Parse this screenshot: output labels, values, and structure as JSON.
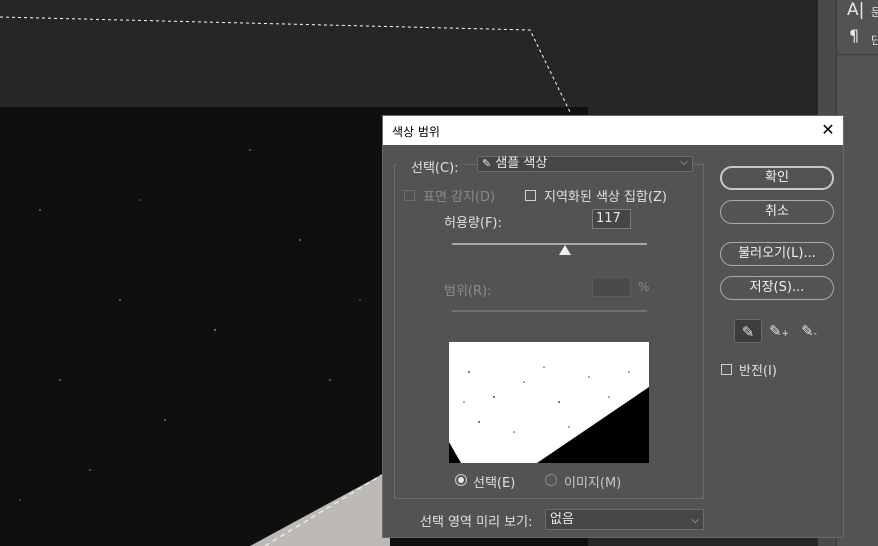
{
  "dialog": {
    "title": "색상 범위",
    "select_label": "선택(C):",
    "select_value": "샘플 색상",
    "face_detect_label": "표면 감지(D)",
    "localized_label": "지역화된 색상 집합(Z)",
    "fuzziness_label": "허용량(F):",
    "fuzziness_value": "117",
    "fuzziness_slider": 0.58,
    "range_label": "범위(R):",
    "range_unit": "%",
    "radio_selection": "선택(E)",
    "radio_image": "이미지(M)",
    "preview_label": "선택 영역 미리 보기:",
    "preview_value": "없음",
    "ok_label": "확인",
    "cancel_label": "취소",
    "load_label": "불러오기(L)...",
    "save_label": "저장(S)...",
    "invert_label": "반전(I)"
  },
  "right_panel": {
    "row1_icon": "A|",
    "row1_text": "문",
    "row2_icon": "¶",
    "row2_text": "단"
  },
  "icons": {
    "eyedropper": "eyedropper-icon",
    "eyedropper_add": "eyedropper-plus-icon",
    "eyedropper_sub": "eyedropper-minus-icon"
  }
}
